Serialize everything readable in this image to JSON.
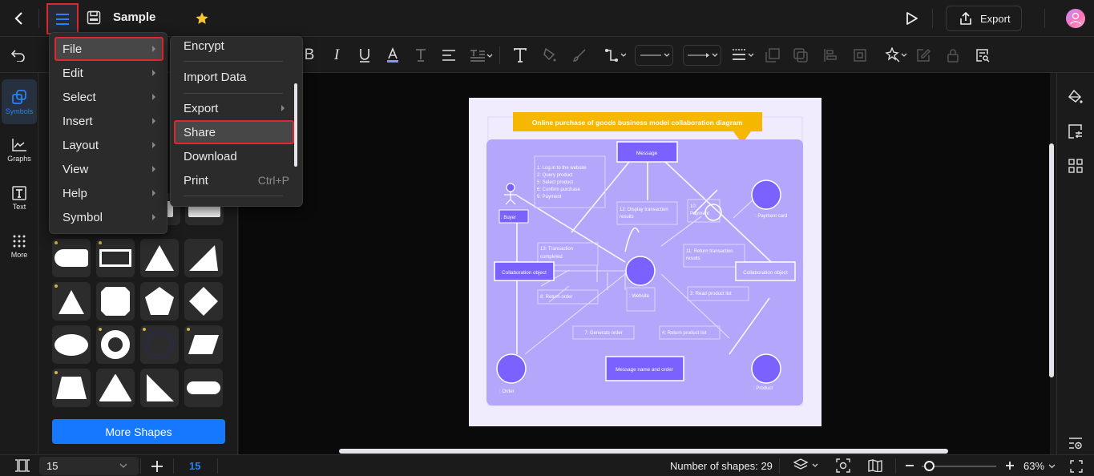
{
  "header": {
    "title": "Sample",
    "export_label": "Export",
    "icons": [
      "back-icon",
      "hamburger-menu-icon",
      "save-icon",
      "star-icon",
      "play-icon",
      "export-icon",
      "avatar"
    ]
  },
  "toolbar": {
    "icons": [
      "undo-icon",
      "bold-icon",
      "italic-icon",
      "underline-icon",
      "font-color-icon",
      "text-strike-icon",
      "align-icon",
      "text-spacing-icon",
      "text-tool-icon",
      "fill-icon",
      "brush-icon",
      "connector-icon",
      "line-style-dropdown",
      "arrow-style-dropdown",
      "line-weight-icon",
      "bring-front-icon",
      "send-back-icon",
      "align-left-icon",
      "group-icon",
      "magic-icon",
      "edit-icon",
      "lock-icon",
      "find-replace-icon"
    ]
  },
  "leftrail": {
    "items": [
      {
        "label": "Symbols",
        "icon": "symbols-icon",
        "active": true
      },
      {
        "label": "Graphs",
        "icon": "graphs-icon",
        "active": false
      },
      {
        "label": "Text",
        "icon": "text-icon",
        "active": false
      },
      {
        "label": "More",
        "icon": "more-grid-icon",
        "active": false
      }
    ]
  },
  "panel": {
    "more_shapes_label": "More Shapes",
    "shapes": [
      "rounded-rect",
      "frame",
      "triangle",
      "right-triangle",
      "triangle-small",
      "octagon",
      "pentagon",
      "diamond",
      "ellipse",
      "donut",
      "double-circle",
      "parallelogram",
      "trapezoid",
      "rounded-triangle",
      "right-angle-triangle",
      "pill"
    ]
  },
  "main_menu": {
    "items": [
      {
        "label": "File",
        "highlighted": true
      },
      {
        "label": "Edit"
      },
      {
        "label": "Select"
      },
      {
        "label": "Insert"
      },
      {
        "label": "Layout"
      },
      {
        "label": "View"
      },
      {
        "label": "Help"
      },
      {
        "label": "Symbol"
      }
    ]
  },
  "file_submenu": {
    "items": [
      {
        "label": "Encrypt"
      },
      {
        "label": "Import Data"
      },
      {
        "label": "Export",
        "submenu": true
      },
      {
        "label": "Share",
        "highlighted": true
      },
      {
        "label": "Download"
      },
      {
        "label": "Print",
        "shortcut": "Ctrl+P"
      }
    ]
  },
  "diagram": {
    "title": "Online purchase of goods business model collaboration diagram",
    "colors": {
      "accent": "#7b61ff",
      "panel": "#b3a6fb",
      "banner": "#f5b700",
      "page": "#f0ecfd"
    },
    "nodes": {
      "message": "Message",
      "buyer": ": Buyer",
      "payment_card": ": Payment card",
      "collab_left": "Collaboration object",
      "collab_right": "Collaboration object",
      "website": ": Website",
      "order": ": Order",
      "product": ": Product",
      "message_name": "Message name and order"
    },
    "labels": {
      "buyer_msgs": [
        "1: Log in to the website",
        "2: Query product",
        "5: Select product",
        "6: Confirm purchase",
        "9: Payment"
      ],
      "display_results": [
        "12: Display transaction",
        "results"
      ],
      "payment": [
        "10:",
        "Payment"
      ],
      "transaction_completed": [
        "13: Transaction",
        "completed"
      ],
      "return_transaction": [
        "11: Return transaction",
        "results"
      ],
      "return_order": "8: Return order",
      "read_product": "3: Read product list",
      "generate_order": "7: Generate order",
      "return_product": "4: Return product list"
    }
  },
  "statusbar": {
    "page_select": "15",
    "page_number": "15",
    "shapes_count": "Number of shapes: 29",
    "zoom": "63%",
    "zoom_fraction": 0.1
  }
}
